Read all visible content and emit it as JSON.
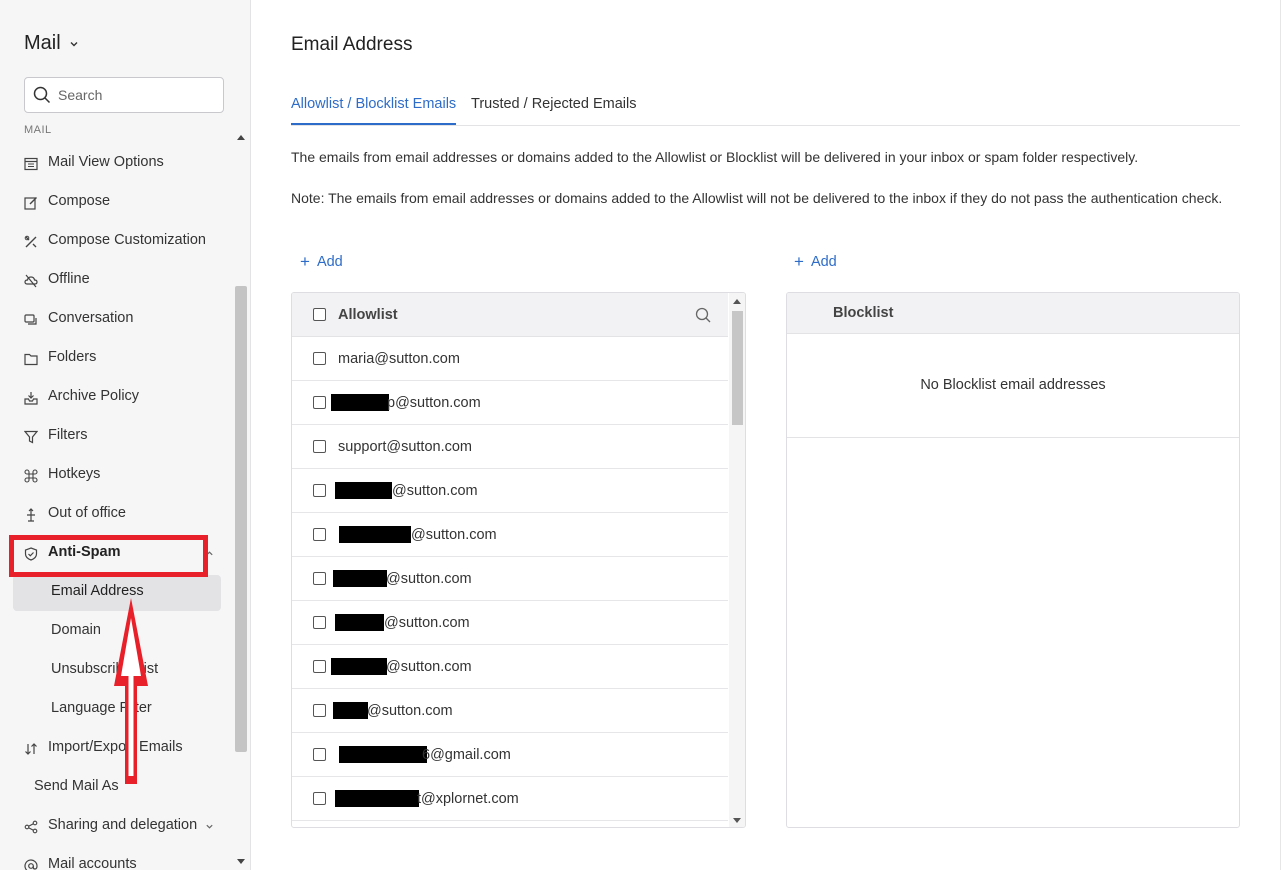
{
  "sidebar": {
    "app_title": "Mail",
    "search_placeholder": "Search",
    "section_label": "MAIL",
    "items": [
      {
        "label": "Mail View Options",
        "icon": "view-options-icon"
      },
      {
        "label": "Compose",
        "icon": "compose-icon"
      },
      {
        "label": "Compose Customization",
        "icon": "customize-icon"
      },
      {
        "label": "Offline",
        "icon": "offline-icon"
      },
      {
        "label": "Conversation",
        "icon": "conversation-icon"
      },
      {
        "label": "Folders",
        "icon": "folder-icon"
      },
      {
        "label": "Archive Policy",
        "icon": "archive-icon"
      },
      {
        "label": "Filters",
        "icon": "filter-icon"
      },
      {
        "label": "Hotkeys",
        "icon": "hotkeys-icon"
      },
      {
        "label": "Out of office",
        "icon": "out-of-office-icon"
      },
      {
        "label": "Anti-Spam",
        "icon": "shield-icon"
      },
      {
        "label": "Email Address"
      },
      {
        "label": "Domain"
      },
      {
        "label": "Unsubscribe List"
      },
      {
        "label": "Language Filter"
      },
      {
        "label": "Import/Export Emails",
        "icon": "import-export-icon"
      },
      {
        "label": "Send Mail As"
      },
      {
        "label": "Sharing and delegation",
        "icon": "share-icon"
      },
      {
        "label": "Mail accounts",
        "icon": "at-icon"
      }
    ]
  },
  "main": {
    "title": "Email Address",
    "tabs": [
      {
        "label": "Allowlist / Blocklist Emails",
        "active": true
      },
      {
        "label": "Trusted / Rejected Emails",
        "active": false
      }
    ],
    "description": "The emails from email addresses or domains added to the Allowlist or Blocklist will be delivered in your inbox or spam folder respectively.",
    "note": "Note: The emails from email addresses or domains added to the Allowlist will not be delivered to the inbox if they do not pass the authentication check.",
    "add_label": "Add",
    "allowlist": {
      "title": "Allowlist",
      "rows": [
        {
          "visible": "maria@sutton.com"
        },
        {
          "visible": "p@sutton.com"
        },
        {
          "visible": "support@sutton.com"
        },
        {
          "visible": "@sutton.com"
        },
        {
          "visible": "@sutton.com"
        },
        {
          "visible": "@sutton.com"
        },
        {
          "visible": "@sutton.com"
        },
        {
          "visible": "@sutton.com"
        },
        {
          "visible": "@sutton.com"
        },
        {
          "visible": "6@gmail.com"
        },
        {
          "visible": "t@xplornet.com"
        }
      ]
    },
    "blocklist": {
      "title": "Blocklist",
      "empty_text": "No Blocklist email addresses"
    }
  },
  "colors": {
    "accent": "#2d6cc9",
    "annotation": "#e8202a",
    "sidebar_bg": "#f6f6f7"
  }
}
